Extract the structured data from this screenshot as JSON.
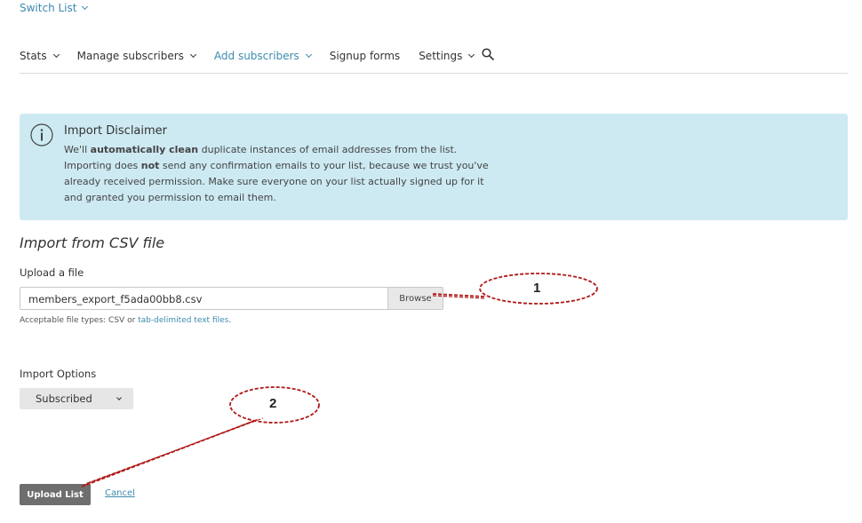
{
  "header": {
    "switch_list": "Switch List"
  },
  "nav": {
    "items": [
      {
        "label": "Stats"
      },
      {
        "label": "Manage subscribers"
      },
      {
        "label": "Add subscribers"
      },
      {
        "label": "Signup forms"
      },
      {
        "label": "Settings"
      }
    ],
    "search_icon": "search-icon"
  },
  "disclaimer": {
    "icon": "info-icon",
    "title": "Import Disclaimer",
    "text_1": "We'll ",
    "text_bold_1": "automatically clean",
    "text_2": " duplicate instances of email addresses from the list. Importing does ",
    "text_bold_2": "not",
    "text_3": " send any confirmation emails to your list, because we trust you've already received permission. Make sure everyone on your list actually signed up for it and granted you permission to email them."
  },
  "import": {
    "title": "Import from CSV file",
    "upload_label": "Upload a file",
    "file_value": "members_export_f5ada00bb8.csv",
    "browse_label": "Browse",
    "types_prefix": "Acceptable file types: CSV or ",
    "types_link": "tab-delimited text files",
    "types_suffix": "."
  },
  "options": {
    "label": "Import Options",
    "selected": "Subscribed"
  },
  "actions": {
    "upload_label": "Upload List",
    "cancel_label": "Cancel"
  },
  "annotations": {
    "callout_1": "1",
    "callout_2": "2",
    "color": "#b01818"
  },
  "colors": {
    "accent": "#3d8bb0",
    "disclaimer_bg": "#cdeaf2",
    "button_bg": "#6e6e6e"
  }
}
